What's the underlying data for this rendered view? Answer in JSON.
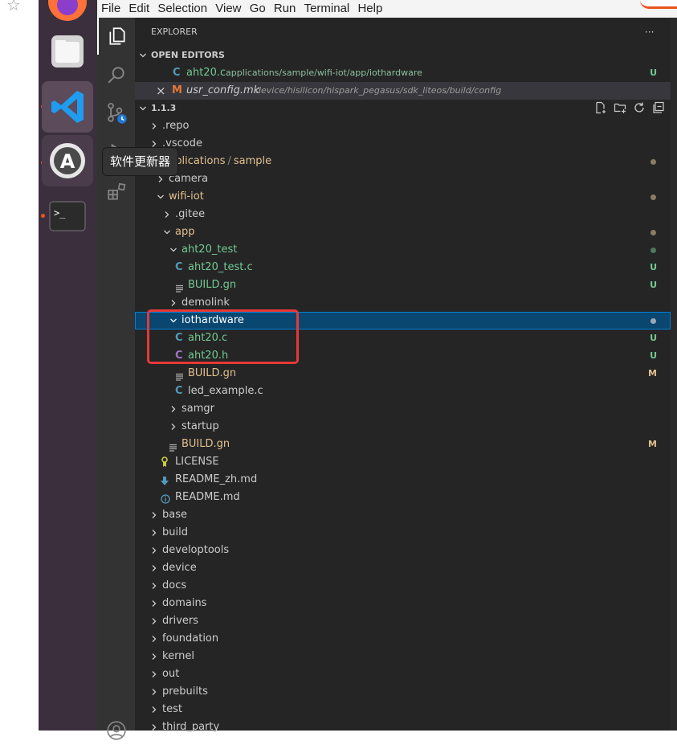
{
  "menu": [
    "File",
    "Edit",
    "Selection",
    "View",
    "Go",
    "Run",
    "Terminal",
    "Help"
  ],
  "tooltip": "软件更新器",
  "explorer": {
    "title": "EXPLORER",
    "more": "···",
    "open_editors_title": "OPEN EDITORS",
    "open_editors": [
      {
        "icon": "C",
        "name": "aht20.c",
        "path": "applications/sample/wifi-iot/app/iothardware",
        "badge": "U"
      },
      {
        "icon": "M",
        "name": "usr_config.mk",
        "path": "device/hisilicon/hispark_pegasus/sdk_liteos/build/config",
        "close": "×"
      }
    ],
    "root": "1.1.3",
    "tree": [
      {
        "label": ".repo"
      },
      {
        "label": ".vscode"
      },
      {
        "label": "applications",
        "sep": "/",
        "label2": "sample",
        "status": "dot"
      },
      {
        "label": "camera"
      },
      {
        "label": "wifi-iot",
        "status": "dot"
      },
      {
        "label": ".gitee"
      },
      {
        "label": "app",
        "status": "dot"
      },
      {
        "label": "aht20_test",
        "status": "dot-green"
      },
      {
        "label": "aht20_test.c",
        "icon": "C",
        "badge": "U"
      },
      {
        "label": "BUILD.gn",
        "badge": "U"
      },
      {
        "label": "demolink"
      },
      {
        "label": "iothardware",
        "status": "dot"
      },
      {
        "label": "aht20.c",
        "icon": "C",
        "badge": "U"
      },
      {
        "label": "aht20.h",
        "icon": "C",
        "badge": "U"
      },
      {
        "label": "BUILD.gn",
        "badge": "M"
      },
      {
        "label": "led_example.c",
        "icon": "C"
      },
      {
        "label": "samgr"
      },
      {
        "label": "startup"
      },
      {
        "label": "BUILD.gn",
        "badge": "M"
      },
      {
        "label": "LICENSE"
      },
      {
        "label": "README_zh.md"
      },
      {
        "label": "README.md"
      },
      {
        "label": "base"
      },
      {
        "label": "build"
      },
      {
        "label": "developtools"
      },
      {
        "label": "device"
      },
      {
        "label": "docs"
      },
      {
        "label": "domains"
      },
      {
        "label": "drivers"
      },
      {
        "label": "foundation"
      },
      {
        "label": "kernel"
      },
      {
        "label": "out"
      },
      {
        "label": "prebuilts"
      },
      {
        "label": "test"
      },
      {
        "label": "third_party"
      }
    ]
  },
  "colors": {
    "untracked": "#73c991",
    "modified": "#e2c08d",
    "c_icon": "#519aba",
    "h_icon": "#a074c4",
    "selection": "#094771",
    "annotation": "#e53935"
  }
}
